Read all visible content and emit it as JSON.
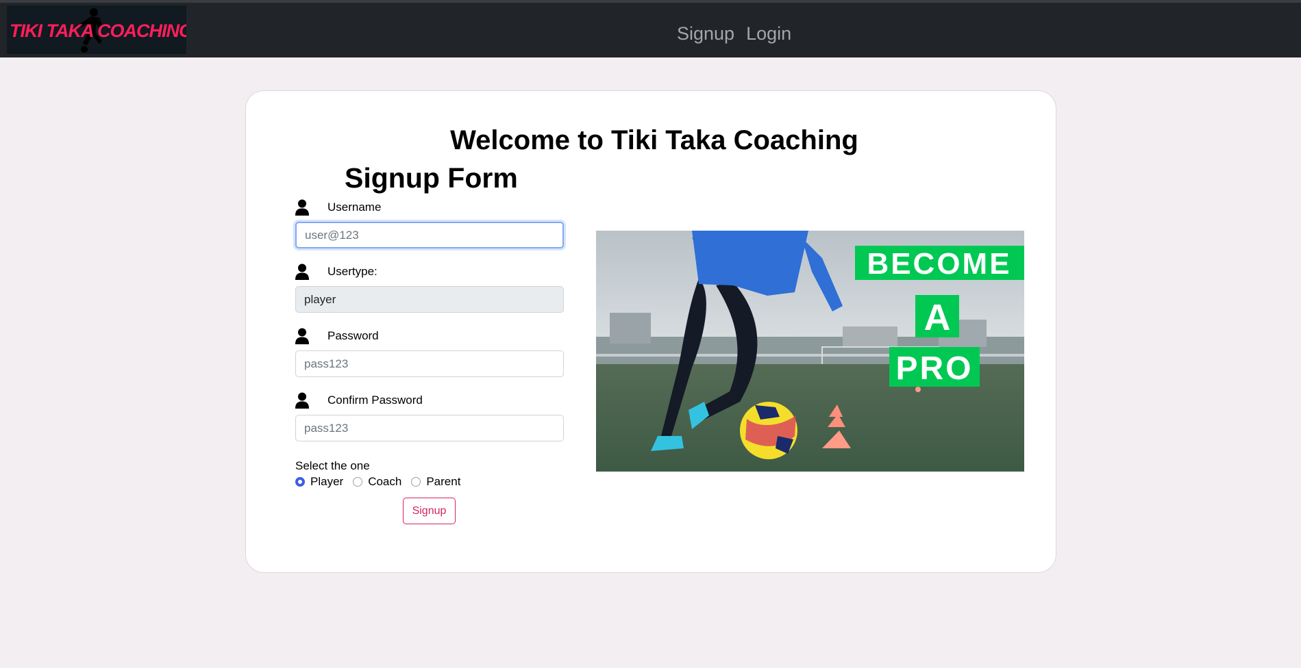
{
  "navbar": {
    "logo_text": "TIKI TAKA COACHING",
    "links": [
      {
        "label": "Signup"
      },
      {
        "label": "Login"
      }
    ]
  },
  "page": {
    "welcome": "Welcome to Tiki Taka Coaching",
    "form_title": "Signup Form"
  },
  "form": {
    "username": {
      "label": "Username",
      "placeholder": "user@123",
      "value": ""
    },
    "usertype": {
      "label": "Usertype:",
      "value": "player"
    },
    "password": {
      "label": "Password",
      "placeholder": "pass123",
      "value": ""
    },
    "confirm_password": {
      "label": "Confirm Password",
      "placeholder": "pass123",
      "value": ""
    },
    "select_label": "Select the one",
    "roles": [
      {
        "label": "Player",
        "checked": true
      },
      {
        "label": "Coach",
        "checked": false
      },
      {
        "label": "Parent",
        "checked": false
      }
    ],
    "submit_label": "Signup"
  },
  "hero": {
    "words": [
      "BECOME",
      "A",
      "PRO"
    ],
    "accent": "#00c853"
  },
  "colors": {
    "navbar": "#212529",
    "brand": "#ff1e5a",
    "button": "#d6245a",
    "radio": "#3d5fe0"
  }
}
